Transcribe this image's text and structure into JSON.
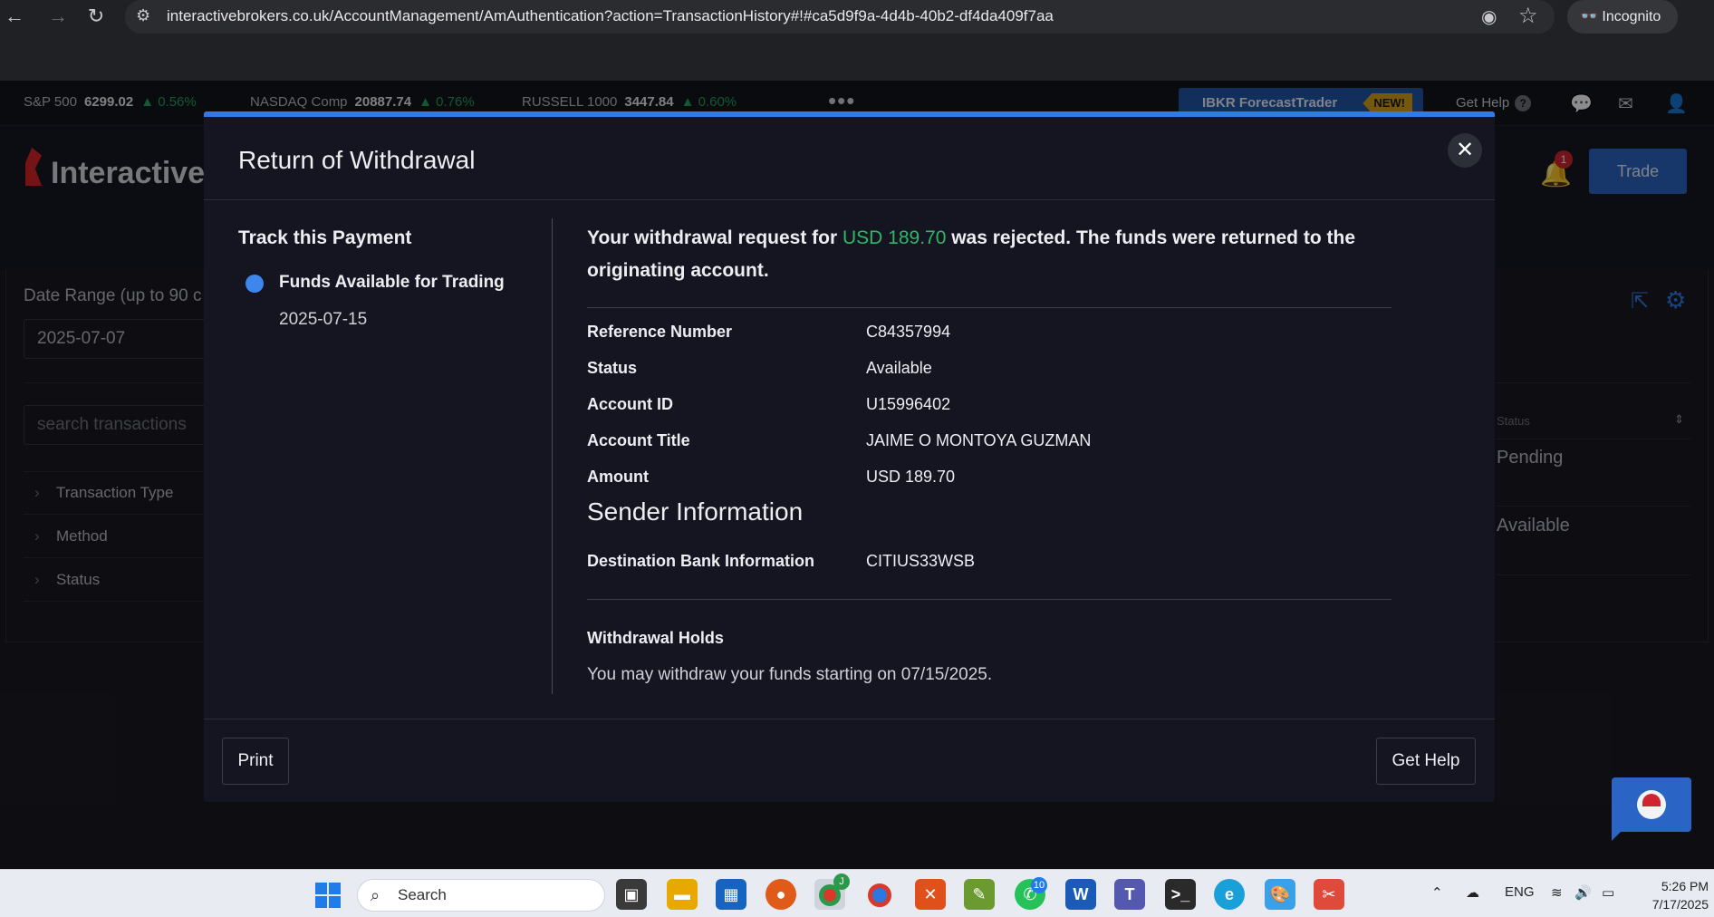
{
  "browser": {
    "url": "interactivebrokers.co.uk/AccountManagement/AmAuthentication?action=TransactionHistory#!#ca5d9f9a-4d4b-40b2-df4da409f7aa",
    "incognito_label": "Incognito"
  },
  "ticker": [
    {
      "name": "S&P 500",
      "value": "6299.02",
      "change": "▲ 0.56%"
    },
    {
      "name": "NASDAQ Comp",
      "value": "20887.74",
      "change": "▲ 0.76%"
    },
    {
      "name": "RUSSELL 1000",
      "value": "3447.84",
      "change": "▲ 0.60%"
    }
  ],
  "topbar": {
    "forecast_label": "IBKR ForecastTrader",
    "new_badge": "NEW!",
    "get_help": "Get Help",
    "help_q": "?"
  },
  "header": {
    "logo_text": "InteractiveB",
    "notification_count": "1",
    "trade_label": "Trade"
  },
  "background": {
    "date_range_label": "Date Range (up to 90 c",
    "date_value": "2025-07-07",
    "search_placeholder": "search transactions",
    "filters": [
      "Transaction Type",
      "Method",
      "Status"
    ],
    "status_header": "Status",
    "status_values": [
      "Pending",
      "Available"
    ]
  },
  "modal": {
    "title": "Return of Withdrawal",
    "track_title": "Track this Payment",
    "track_step": "Funds Available for Trading",
    "track_date": "2025-07-15",
    "headline_pre": "Your withdrawal request for ",
    "headline_amount": "USD 189.70",
    "headline_post": " was rejected. The funds were returned to the originating account.",
    "details": [
      {
        "label": "Reference Number",
        "value": "C84357994"
      },
      {
        "label": "Status",
        "value": "Available"
      },
      {
        "label": "Account ID",
        "value": "U15996402"
      },
      {
        "label": "Account Title",
        "value": "JAIME O MONTOYA GUZMAN"
      },
      {
        "label": "Amount",
        "value": "USD 189.70"
      }
    ],
    "sender_heading": "Sender Information",
    "destination_label": "Destination Bank Information",
    "destination_value": "CITIUS33WSB",
    "holds_title": "Withdrawal Holds",
    "holds_text": "You may withdraw your funds starting on 07/15/2025.",
    "print_label": "Print",
    "get_help_label": "Get Help"
  },
  "taskbar": {
    "search_label": "Search",
    "whatsapp_badge": "10",
    "chrome_badge": "J",
    "lang": "ENG",
    "time": "5:26 PM",
    "date": "7/17/2025"
  },
  "colors": {
    "accent_blue": "#2f7be8",
    "positive_green": "#2fb868",
    "modal_bg": "#141520"
  }
}
